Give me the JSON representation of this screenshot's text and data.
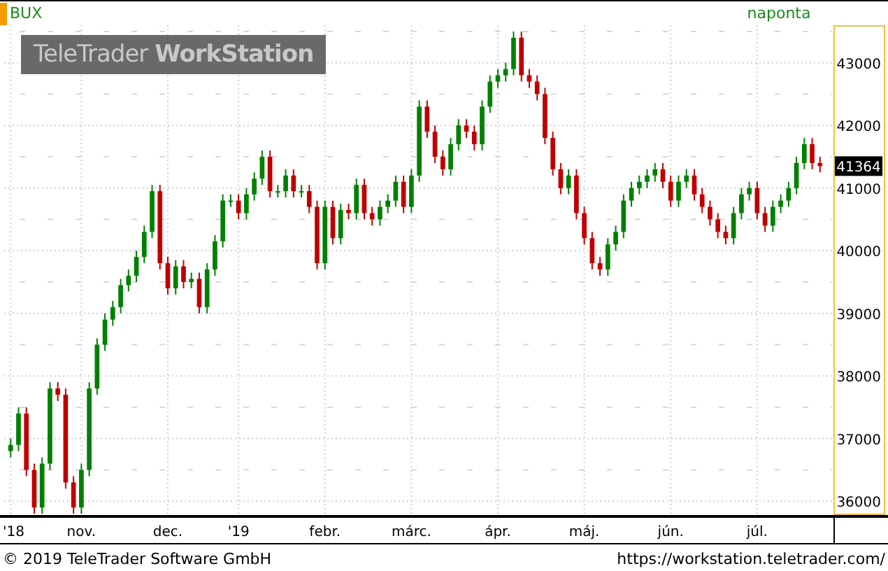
{
  "header": {
    "symbol": "BUX",
    "interval": "naponta"
  },
  "logo": "TeleTrader **WorkStation**",
  "chart": {
    "last_price": "41364",
    "chart_data": {
      "type": "candlestick",
      "grid": true,
      "ylim": [
        35780,
        43600
      ],
      "yticks": [
        36000,
        37000,
        38000,
        39000,
        40000,
        41000,
        42000,
        43000
      ],
      "categories": [
        "'18",
        null,
        null,
        null,
        null,
        null,
        null,
        null,
        null,
        "nov.",
        null,
        null,
        null,
        null,
        null,
        null,
        null,
        null,
        null,
        null,
        "dec.",
        null,
        null,
        null,
        null,
        null,
        null,
        null,
        null,
        "'19",
        null,
        null,
        null,
        null,
        null,
        null,
        null,
        null,
        null,
        null,
        "febr.",
        null,
        null,
        null,
        null,
        null,
        null,
        null,
        null,
        null,
        null,
        "márc.",
        null,
        null,
        null,
        null,
        null,
        null,
        null,
        null,
        null,
        null,
        "ápr.",
        null,
        null,
        null,
        null,
        null,
        null,
        null,
        null,
        null,
        null,
        "máj.",
        null,
        null,
        null,
        null,
        null,
        null,
        null,
        null,
        null,
        null,
        "jún.",
        null,
        null,
        null,
        null,
        null,
        null,
        null,
        null,
        null,
        null,
        "júl.",
        null,
        null,
        null,
        null,
        null,
        null,
        null,
        null
      ],
      "ohlc": [
        [
          36800,
          37000,
          36700,
          36900
        ],
        [
          36900,
          37500,
          36800,
          37400
        ],
        [
          37400,
          37500,
          36400,
          36500
        ],
        [
          36500,
          36600,
          35800,
          35900
        ],
        [
          35900,
          36700,
          35800,
          36600
        ],
        [
          36600,
          37900,
          36500,
          37800
        ],
        [
          37800,
          37900,
          37600,
          37700
        ],
        [
          37700,
          37800,
          36200,
          36300
        ],
        [
          36300,
          36400,
          35800,
          35900
        ],
        [
          35900,
          36600,
          35800,
          36500
        ],
        [
          36500,
          37900,
          36400,
          37800
        ],
        [
          37800,
          38600,
          37700,
          38500
        ],
        [
          38500,
          39000,
          38400,
          38900
        ],
        [
          38900,
          39200,
          38800,
          39100
        ],
        [
          39100,
          39550,
          39000,
          39450
        ],
        [
          39450,
          39700,
          39350,
          39600
        ],
        [
          39600,
          40000,
          39500,
          39900
        ],
        [
          39900,
          40400,
          39800,
          40300
        ],
        [
          40300,
          41050,
          40200,
          40950
        ],
        [
          40950,
          41050,
          39700,
          39800
        ],
        [
          39800,
          39900,
          39300,
          39400
        ],
        [
          39400,
          39850,
          39300,
          39750
        ],
        [
          39750,
          39850,
          39400,
          39500
        ],
        [
          39500,
          39650,
          39400,
          39550
        ],
        [
          39550,
          39650,
          39000,
          39100
        ],
        [
          39100,
          39800,
          39000,
          39700
        ],
        [
          39700,
          40250,
          39600,
          40150
        ],
        [
          40150,
          40900,
          40050,
          40800
        ],
        [
          40800,
          40900,
          40700,
          40800
        ],
        [
          40800,
          40900,
          40500,
          40600
        ],
        [
          40600,
          41000,
          40500,
          40900
        ],
        [
          40900,
          41250,
          40800,
          41150
        ],
        [
          41150,
          41600,
          41050,
          41500
        ],
        [
          41500,
          41600,
          40850,
          40950
        ],
        [
          40950,
          41050,
          40850,
          40950
        ],
        [
          40950,
          41300,
          40850,
          41200
        ],
        [
          41200,
          41300,
          40850,
          40950
        ],
        [
          40950,
          41050,
          40850,
          40950
        ],
        [
          40950,
          41050,
          40600,
          40700
        ],
        [
          40700,
          40800,
          39700,
          39800
        ],
        [
          39800,
          40800,
          39700,
          40700
        ],
        [
          40700,
          40800,
          40100,
          40200
        ],
        [
          40200,
          40750,
          40100,
          40650
        ],
        [
          40650,
          40750,
          40500,
          40600
        ],
        [
          40600,
          41150,
          40500,
          41050
        ],
        [
          41050,
          41150,
          40500,
          40600
        ],
        [
          40600,
          40700,
          40400,
          40500
        ],
        [
          40500,
          40800,
          40400,
          40700
        ],
        [
          40700,
          40900,
          40600,
          40800
        ],
        [
          40800,
          41200,
          40700,
          41100
        ],
        [
          41100,
          41200,
          40600,
          40700
        ],
        [
          40700,
          41300,
          40600,
          41200
        ],
        [
          41200,
          42400,
          41100,
          42300
        ],
        [
          42300,
          42400,
          41800,
          41900
        ],
        [
          41900,
          42000,
          41400,
          41500
        ],
        [
          41500,
          41600,
          41200,
          41300
        ],
        [
          41300,
          41800,
          41200,
          41700
        ],
        [
          41700,
          42100,
          41600,
          42000
        ],
        [
          42000,
          42100,
          41800,
          41900
        ],
        [
          41900,
          42000,
          41600,
          41700
        ],
        [
          41700,
          42400,
          41600,
          42300
        ],
        [
          42300,
          42800,
          42200,
          42700
        ],
        [
          42700,
          42900,
          42600,
          42800
        ],
        [
          42800,
          43000,
          42700,
          42900
        ],
        [
          42900,
          43500,
          42800,
          43400
        ],
        [
          43400,
          43500,
          42700,
          42800
        ],
        [
          42800,
          42900,
          42600,
          42700
        ],
        [
          42700,
          42800,
          42400,
          42500
        ],
        [
          42500,
          42600,
          41700,
          41800
        ],
        [
          41800,
          41900,
          41200,
          41300
        ],
        [
          41300,
          41400,
          40900,
          41000
        ],
        [
          41000,
          41300,
          40900,
          41200
        ],
        [
          41200,
          41300,
          40500,
          40600
        ],
        [
          40600,
          40700,
          40100,
          40200
        ],
        [
          40200,
          40300,
          39700,
          39800
        ],
        [
          39800,
          39900,
          39600,
          39700
        ],
        [
          39700,
          40200,
          39600,
          40100
        ],
        [
          40100,
          40400,
          40000,
          40300
        ],
        [
          40300,
          40900,
          40200,
          40800
        ],
        [
          40800,
          41100,
          40700,
          41000
        ],
        [
          41000,
          41200,
          40900,
          41100
        ],
        [
          41100,
          41300,
          41000,
          41200
        ],
        [
          41200,
          41400,
          41100,
          41300
        ],
        [
          41300,
          41400,
          41000,
          41100
        ],
        [
          41100,
          41200,
          40700,
          40800
        ],
        [
          40800,
          41200,
          40700,
          41100
        ],
        [
          41100,
          41300,
          41000,
          41200
        ],
        [
          41200,
          41300,
          40800,
          40900
        ],
        [
          40900,
          41000,
          40600,
          40700
        ],
        [
          40700,
          40800,
          40400,
          40500
        ],
        [
          40500,
          40600,
          40200,
          40300
        ],
        [
          40300,
          40400,
          40100,
          40200
        ],
        [
          40200,
          40700,
          40100,
          40600
        ],
        [
          40600,
          41000,
          40500,
          40900
        ],
        [
          40900,
          41100,
          40800,
          41000
        ],
        [
          41000,
          41100,
          40500,
          40600
        ],
        [
          40600,
          40700,
          40300,
          40400
        ],
        [
          40400,
          40800,
          40300,
          40700
        ],
        [
          40700,
          40900,
          40600,
          40800
        ],
        [
          40800,
          41100,
          40700,
          41000
        ],
        [
          41000,
          41500,
          40900,
          41400
        ],
        [
          41400,
          41800,
          41300,
          41700
        ],
        [
          41700,
          41800,
          41300,
          41400
        ],
        [
          41400,
          41500,
          41250,
          41350
        ]
      ]
    }
  },
  "footer": {
    "copyright": "© 2019 TeleTrader Software GmbH",
    "url": "https://workstation.teletrader.com/"
  }
}
